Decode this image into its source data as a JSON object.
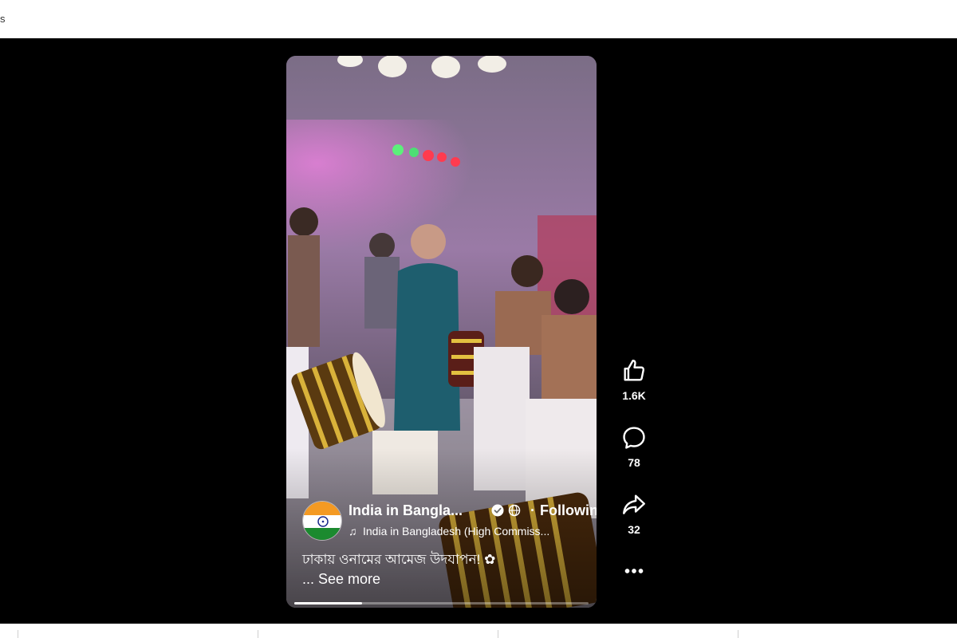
{
  "top_bar": {
    "clip_text": "s"
  },
  "video": {
    "progress": 0.23,
    "page_name": "India in Bangla...",
    "follow_status": "Following",
    "audio_label": "India in Bangladesh (High Commiss...",
    "caption": "ঢাকায় ওনামের আমেজ উদযাপন! ✿",
    "see_more": "... See more",
    "icons": {
      "avatar": "india-flag-icon",
      "verified": "verified-badge-icon",
      "privacy": "globe-icon",
      "audio": "music-note-icon"
    }
  },
  "actions": {
    "like_count": "1.6K",
    "comment_count": "78",
    "share_count": "32",
    "icons": [
      "thumbs-up-icon",
      "comment-icon",
      "share-icon",
      "more-icon"
    ]
  },
  "colors": {
    "background": "#000000",
    "text": "#ffffff",
    "saffron": "#f49a23",
    "green": "#1b8a2f",
    "chakra": "#1a2a8a"
  }
}
